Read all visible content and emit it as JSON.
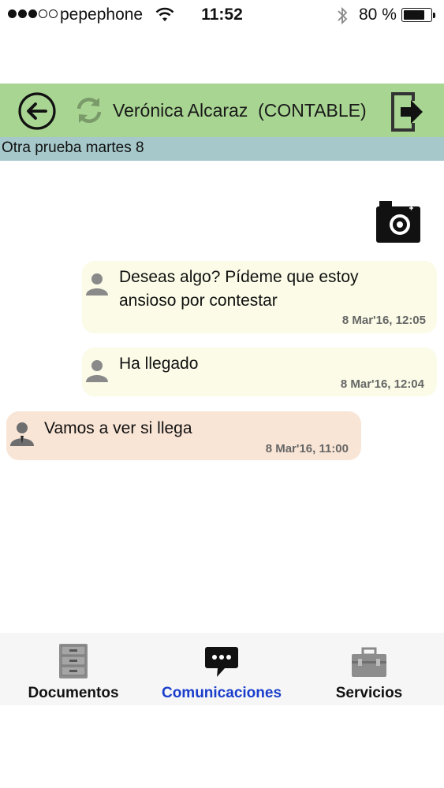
{
  "status_bar": {
    "carrier": "pepephone",
    "time": "11:52",
    "battery_percent": "80 %",
    "battery_level": 0.8,
    "signal_bars_filled": 3,
    "signal_bars_total": 5
  },
  "header": {
    "title": "Verónica Alcaraz  (CONTABLE)",
    "back_icon": "back-arrow-circle-icon",
    "refresh_icon": "refresh-icon",
    "logout_icon": "logout-icon",
    "background_color": "#a8d592"
  },
  "subject": {
    "text": "Otra prueba martes 8",
    "background_color": "#a6c8cb"
  },
  "messages": [
    {
      "direction": "outgoing",
      "lines": [
        "Deseas algo?  Pídeme que estoy",
        "ansioso por contestar"
      ],
      "timestamp": "8 Mar'16, 12:05"
    },
    {
      "direction": "outgoing",
      "lines": [
        "Ha llegado"
      ],
      "timestamp": "8 Mar'16, 12:04"
    },
    {
      "direction": "incoming",
      "lines": [
        "Vamos a ver si llega"
      ],
      "timestamp": "8 Mar'16, 11:00"
    }
  ],
  "tabs": [
    {
      "label": "Documentos",
      "icon": "file-cabinet-icon",
      "active": false
    },
    {
      "label": "Comunicaciones",
      "icon": "chat-bubble-icon",
      "active": true
    },
    {
      "label": "Servicios",
      "icon": "toolbox-icon",
      "active": false
    }
  ],
  "colors": {
    "outgoing_bubble": "#fbfbe7",
    "incoming_bubble": "#f9e5d6",
    "active_tab": "#1a3ecb"
  }
}
